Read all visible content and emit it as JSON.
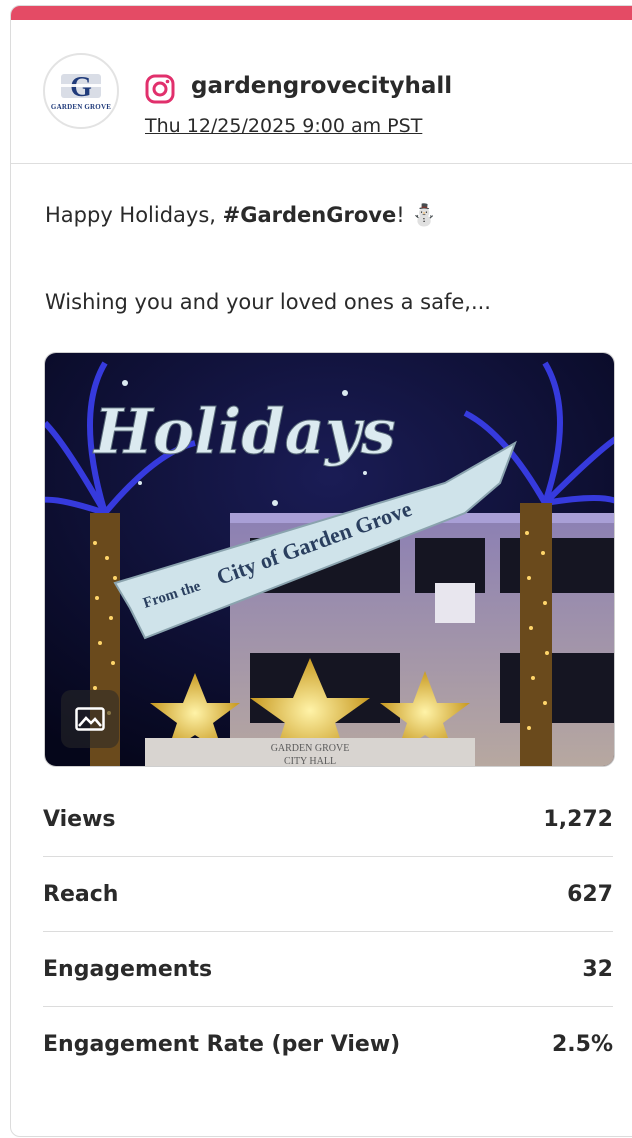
{
  "post": {
    "platform_icon": "instagram-icon",
    "avatar_text": "GARDEN GROVE",
    "handle": "gardengrovecityhall",
    "date": "Thu 12/25/2025 9:00 am PST",
    "caption_prefix": "Happy Holidays, ",
    "caption_hashtag": "#GardenGrove",
    "caption_suffix": "! ⛄",
    "caption_line2": "Wishing you and your loved ones a safe,..."
  },
  "image": {
    "title": "Holidays",
    "banner_small": "From the",
    "banner_large": "City of Garden Grove",
    "building_sign_1": "GARDEN GROVE",
    "building_sign_2": "CITY HALL",
    "type_icon": "image-icon"
  },
  "stats": [
    {
      "label": "Views",
      "value": "1,272"
    },
    {
      "label": "Reach",
      "value": "627"
    },
    {
      "label": "Engagements",
      "value": "32"
    },
    {
      "label": "Engagement Rate (per View)",
      "value": "2.5%"
    }
  ],
  "colors": {
    "accent_bar": "#e44b65",
    "instagram": "#e1306c",
    "banner": "#cfe3ea"
  }
}
